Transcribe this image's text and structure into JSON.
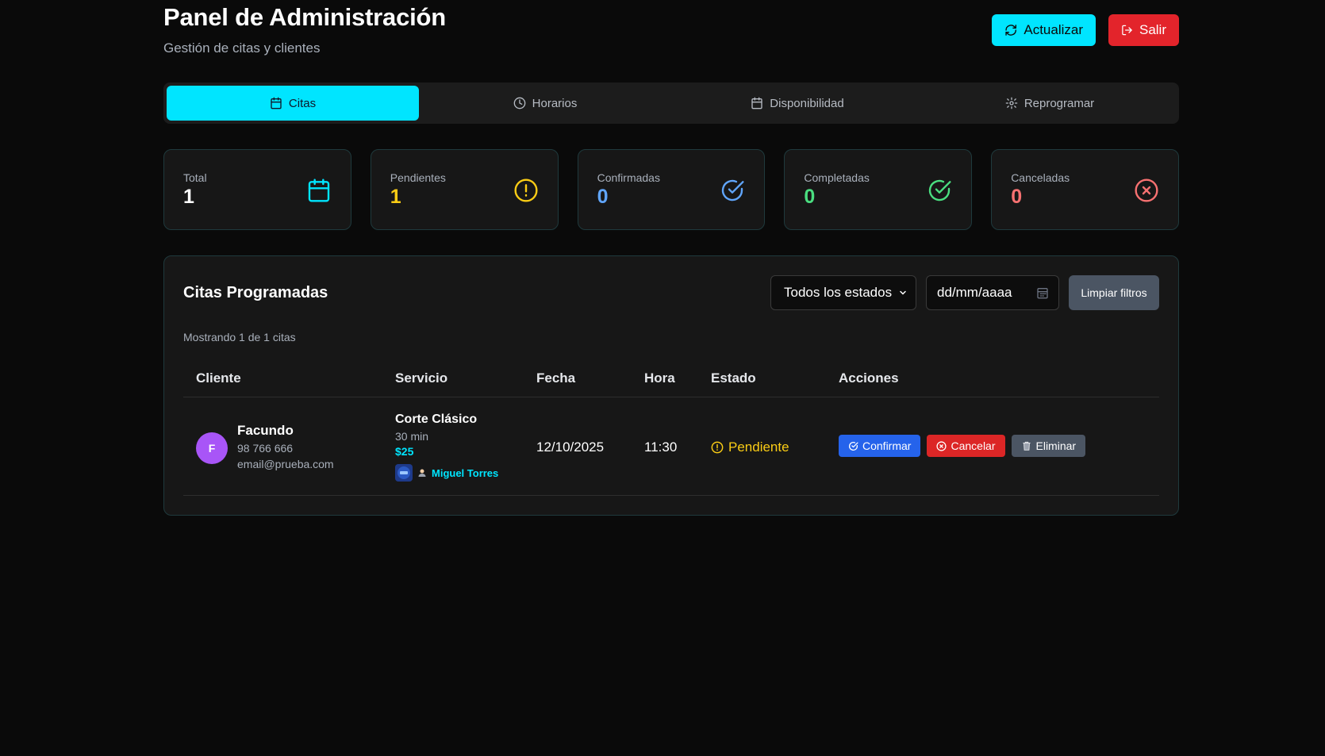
{
  "header": {
    "title": "Panel de Administración",
    "subtitle": "Gestión de citas y clientes",
    "refresh_label": "Actualizar",
    "exit_label": "Salir"
  },
  "tabs": [
    {
      "label": "Citas",
      "icon": "calendar-icon",
      "active": true
    },
    {
      "label": "Horarios",
      "icon": "clock-icon",
      "active": false
    },
    {
      "label": "Disponibilidad",
      "icon": "calendar-icon",
      "active": false
    },
    {
      "label": "Reprogramar",
      "icon": "gear-icon",
      "active": false
    }
  ],
  "stats": [
    {
      "label": "Total",
      "value": "1",
      "color": "#ffffff",
      "icon": "calendar-icon",
      "icon_color": "#00e5ff"
    },
    {
      "label": "Pendientes",
      "value": "1",
      "color": "#facc15",
      "icon": "alert-circle-icon",
      "icon_color": "#facc15"
    },
    {
      "label": "Confirmadas",
      "value": "0",
      "color": "#60a5fa",
      "icon": "check-circle-icon",
      "icon_color": "#60a5fa"
    },
    {
      "label": "Completadas",
      "value": "0",
      "color": "#4ade80",
      "icon": "check-circle-icon",
      "icon_color": "#4ade80"
    },
    {
      "label": "Canceladas",
      "value": "0",
      "color": "#f87171",
      "icon": "x-circle-icon",
      "icon_color": "#f87171"
    }
  ],
  "appointments": {
    "title": "Citas Programadas",
    "status_filter": "Todos los estados",
    "date_placeholder": "dd/mm/aaaa",
    "clear_label": "Limpiar filtros",
    "count_text": "Mostrando 1 de 1 citas",
    "columns": [
      "Cliente",
      "Servicio",
      "Fecha",
      "Hora",
      "Estado",
      "Acciones"
    ],
    "rows": [
      {
        "initial": "F",
        "client": "Facundo",
        "phone": "98 766 666",
        "email": "email@prueba.com",
        "service": "Corte Clásico",
        "duration": "30 min",
        "price": "$25",
        "barber": "Miguel Torres",
        "date": "12/10/2025",
        "time": "11:30",
        "status": "Pendiente",
        "actions": {
          "confirm": "Confirmar",
          "cancel": "Cancelar",
          "delete": "Eliminar"
        }
      }
    ]
  },
  "colors": {
    "accent": "#00e5ff",
    "danger": "#e3242b",
    "background": "#0a0a0a",
    "avatar": "#a855f7",
    "pending": "#facc15"
  }
}
